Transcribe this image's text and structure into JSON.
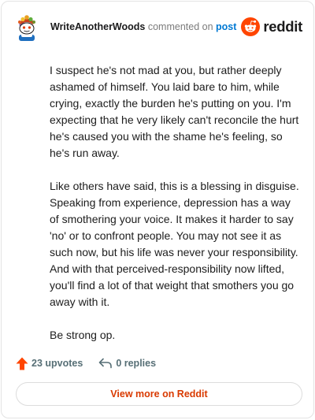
{
  "header": {
    "username": "WriteAnotherWoods",
    "action_text": "commented on",
    "link_text": "post",
    "avatar_icon": "snoo-avatar-icon",
    "brand_icon": "reddit-logo-icon",
    "brand_text": "reddit",
    "brand_color": "#ff4500"
  },
  "comment": {
    "paragraphs": [
      "I suspect he's not mad at you, but rather deeply ashamed of himself. You laid bare to him, while crying, exactly the burden he's putting on you. I'm expecting that he very likely can't reconcile the hurt he's caused you with the shame he's feeling, so he's run away.",
      "Like others have said, this is a blessing in disguise. Speaking from experience, depression has a way of smothering your voice. It makes it harder to say 'no' or to confront people. You may not see it as such now, but his life was never your responsibility. And with that perceived-responsibility now lifted, you'll find a lot of that weight that smothers you go away with it.",
      "Be strong op."
    ]
  },
  "actions": {
    "upvotes": "23 upvotes",
    "upvote_icon": "upvote-arrow-icon",
    "upvote_color": "#ff4500",
    "replies": "0 replies",
    "reply_icon": "reply-arrow-icon"
  },
  "footer": {
    "view_more": "View more on Reddit",
    "view_more_color": "#d93a00"
  }
}
